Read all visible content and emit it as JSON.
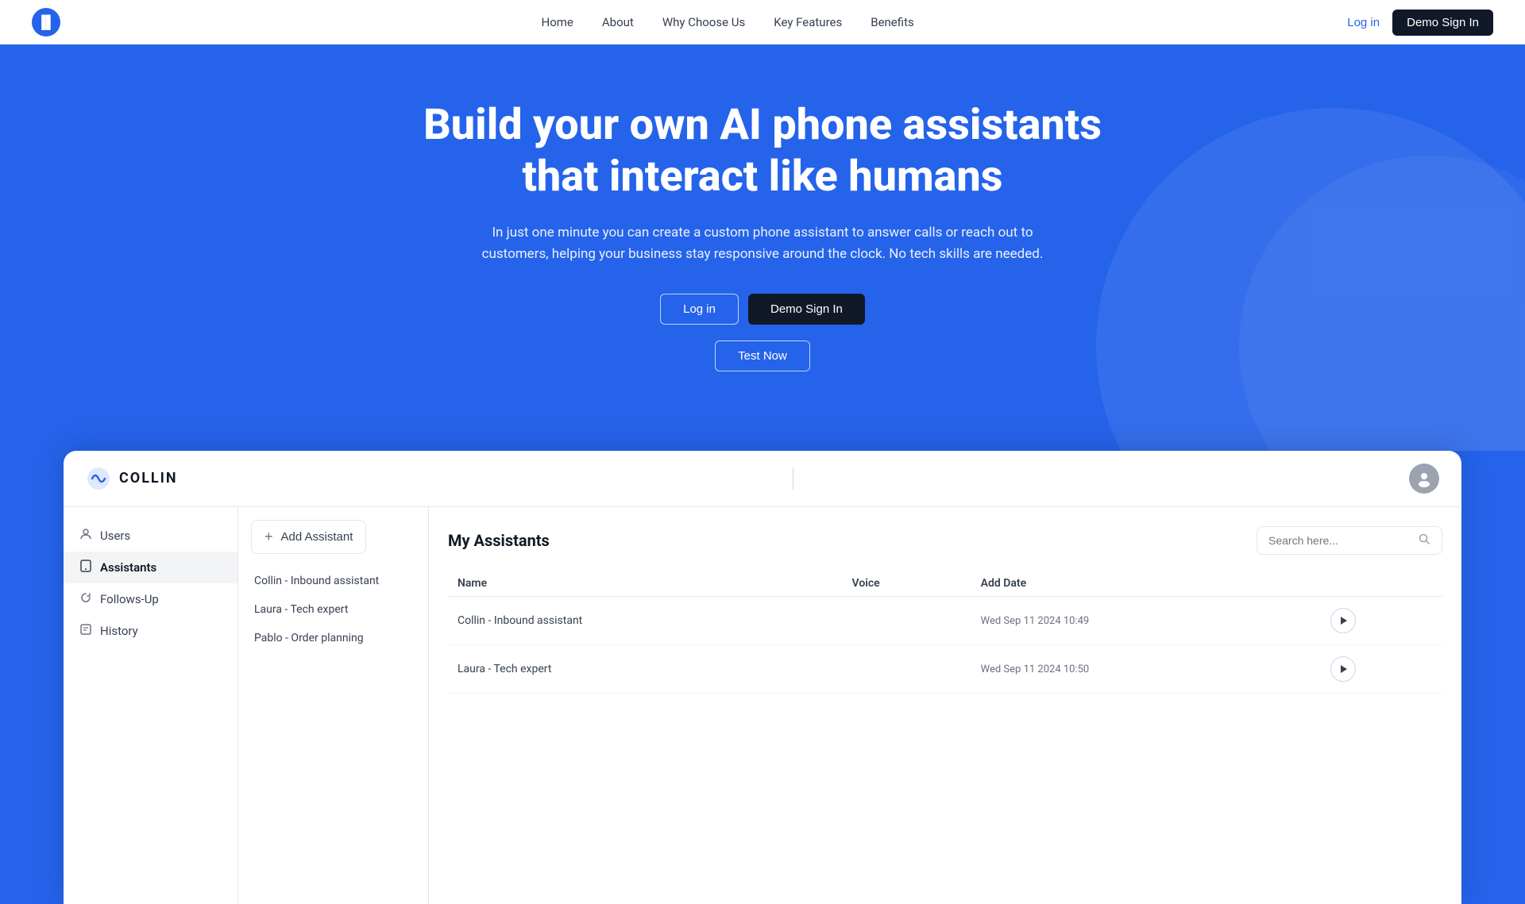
{
  "navbar": {
    "logo_text": "▐▌",
    "nav_items": [
      "Home",
      "About",
      "Why Choose Us",
      "Key Features",
      "Benefits"
    ],
    "login_label": "Log in",
    "demo_sign_in_label": "Demo Sign In"
  },
  "hero": {
    "title": "Build your own AI phone assistants that interact like humans",
    "subtitle": "In just one minute you can create a custom phone assistant to answer calls or reach out to customers, helping your business stay responsive around the clock. No tech skills are needed.",
    "login_label": "Log in",
    "demo_label": "Demo Sign In",
    "test_label": "Test Now"
  },
  "app": {
    "logo_text": "COLLIN",
    "header": {
      "avatar_icon": "👤"
    },
    "sidebar": {
      "items": [
        {
          "label": "Users",
          "icon": "👤"
        },
        {
          "label": "Assistants",
          "icon": "📞",
          "active": true
        },
        {
          "label": "Follows-Up",
          "icon": "🔄"
        },
        {
          "label": "History",
          "icon": "📋"
        }
      ]
    },
    "middle_panel": {
      "add_button_label": "Add Assistant",
      "assistants": [
        {
          "name": "Collin - Inbound assistant"
        },
        {
          "name": "Laura - Tech expert"
        },
        {
          "name": "Pablo - Order planning"
        }
      ]
    },
    "main_panel": {
      "title": "My Assistants",
      "search_placeholder": "Search here...",
      "table": {
        "columns": [
          "Name",
          "Voice",
          "Add Date"
        ],
        "rows": [
          {
            "name": "Collin - Inbound assistant",
            "voice": "",
            "add_date": "Wed Sep 11 2024  10:49"
          },
          {
            "name": "Laura - Tech expert",
            "voice": "",
            "add_date": "Wed Sep 11 2024  10:50"
          }
        ]
      }
    }
  }
}
